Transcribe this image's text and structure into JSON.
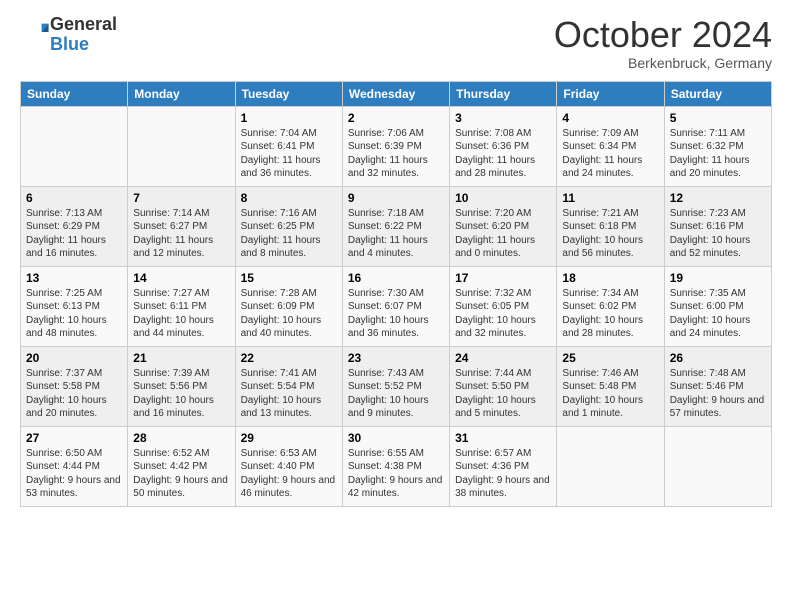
{
  "header": {
    "logo_line1": "General",
    "logo_line2": "Blue",
    "month": "October 2024",
    "location": "Berkenbruck, Germany"
  },
  "days_of_week": [
    "Sunday",
    "Monday",
    "Tuesday",
    "Wednesday",
    "Thursday",
    "Friday",
    "Saturday"
  ],
  "weeks": [
    [
      {
        "day": "",
        "info": ""
      },
      {
        "day": "",
        "info": ""
      },
      {
        "day": "1",
        "info": "Sunrise: 7:04 AM\nSunset: 6:41 PM\nDaylight: 11 hours and 36 minutes."
      },
      {
        "day": "2",
        "info": "Sunrise: 7:06 AM\nSunset: 6:39 PM\nDaylight: 11 hours and 32 minutes."
      },
      {
        "day": "3",
        "info": "Sunrise: 7:08 AM\nSunset: 6:36 PM\nDaylight: 11 hours and 28 minutes."
      },
      {
        "day": "4",
        "info": "Sunrise: 7:09 AM\nSunset: 6:34 PM\nDaylight: 11 hours and 24 minutes."
      },
      {
        "day": "5",
        "info": "Sunrise: 7:11 AM\nSunset: 6:32 PM\nDaylight: 11 hours and 20 minutes."
      }
    ],
    [
      {
        "day": "6",
        "info": "Sunrise: 7:13 AM\nSunset: 6:29 PM\nDaylight: 11 hours and 16 minutes."
      },
      {
        "day": "7",
        "info": "Sunrise: 7:14 AM\nSunset: 6:27 PM\nDaylight: 11 hours and 12 minutes."
      },
      {
        "day": "8",
        "info": "Sunrise: 7:16 AM\nSunset: 6:25 PM\nDaylight: 11 hours and 8 minutes."
      },
      {
        "day": "9",
        "info": "Sunrise: 7:18 AM\nSunset: 6:22 PM\nDaylight: 11 hours and 4 minutes."
      },
      {
        "day": "10",
        "info": "Sunrise: 7:20 AM\nSunset: 6:20 PM\nDaylight: 11 hours and 0 minutes."
      },
      {
        "day": "11",
        "info": "Sunrise: 7:21 AM\nSunset: 6:18 PM\nDaylight: 10 hours and 56 minutes."
      },
      {
        "day": "12",
        "info": "Sunrise: 7:23 AM\nSunset: 6:16 PM\nDaylight: 10 hours and 52 minutes."
      }
    ],
    [
      {
        "day": "13",
        "info": "Sunrise: 7:25 AM\nSunset: 6:13 PM\nDaylight: 10 hours and 48 minutes."
      },
      {
        "day": "14",
        "info": "Sunrise: 7:27 AM\nSunset: 6:11 PM\nDaylight: 10 hours and 44 minutes."
      },
      {
        "day": "15",
        "info": "Sunrise: 7:28 AM\nSunset: 6:09 PM\nDaylight: 10 hours and 40 minutes."
      },
      {
        "day": "16",
        "info": "Sunrise: 7:30 AM\nSunset: 6:07 PM\nDaylight: 10 hours and 36 minutes."
      },
      {
        "day": "17",
        "info": "Sunrise: 7:32 AM\nSunset: 6:05 PM\nDaylight: 10 hours and 32 minutes."
      },
      {
        "day": "18",
        "info": "Sunrise: 7:34 AM\nSunset: 6:02 PM\nDaylight: 10 hours and 28 minutes."
      },
      {
        "day": "19",
        "info": "Sunrise: 7:35 AM\nSunset: 6:00 PM\nDaylight: 10 hours and 24 minutes."
      }
    ],
    [
      {
        "day": "20",
        "info": "Sunrise: 7:37 AM\nSunset: 5:58 PM\nDaylight: 10 hours and 20 minutes."
      },
      {
        "day": "21",
        "info": "Sunrise: 7:39 AM\nSunset: 5:56 PM\nDaylight: 10 hours and 16 minutes."
      },
      {
        "day": "22",
        "info": "Sunrise: 7:41 AM\nSunset: 5:54 PM\nDaylight: 10 hours and 13 minutes."
      },
      {
        "day": "23",
        "info": "Sunrise: 7:43 AM\nSunset: 5:52 PM\nDaylight: 10 hours and 9 minutes."
      },
      {
        "day": "24",
        "info": "Sunrise: 7:44 AM\nSunset: 5:50 PM\nDaylight: 10 hours and 5 minutes."
      },
      {
        "day": "25",
        "info": "Sunrise: 7:46 AM\nSunset: 5:48 PM\nDaylight: 10 hours and 1 minute."
      },
      {
        "day": "26",
        "info": "Sunrise: 7:48 AM\nSunset: 5:46 PM\nDaylight: 9 hours and 57 minutes."
      }
    ],
    [
      {
        "day": "27",
        "info": "Sunrise: 6:50 AM\nSunset: 4:44 PM\nDaylight: 9 hours and 53 minutes."
      },
      {
        "day": "28",
        "info": "Sunrise: 6:52 AM\nSunset: 4:42 PM\nDaylight: 9 hours and 50 minutes."
      },
      {
        "day": "29",
        "info": "Sunrise: 6:53 AM\nSunset: 4:40 PM\nDaylight: 9 hours and 46 minutes."
      },
      {
        "day": "30",
        "info": "Sunrise: 6:55 AM\nSunset: 4:38 PM\nDaylight: 9 hours and 42 minutes."
      },
      {
        "day": "31",
        "info": "Sunrise: 6:57 AM\nSunset: 4:36 PM\nDaylight: 9 hours and 38 minutes."
      },
      {
        "day": "",
        "info": ""
      },
      {
        "day": "",
        "info": ""
      }
    ]
  ]
}
